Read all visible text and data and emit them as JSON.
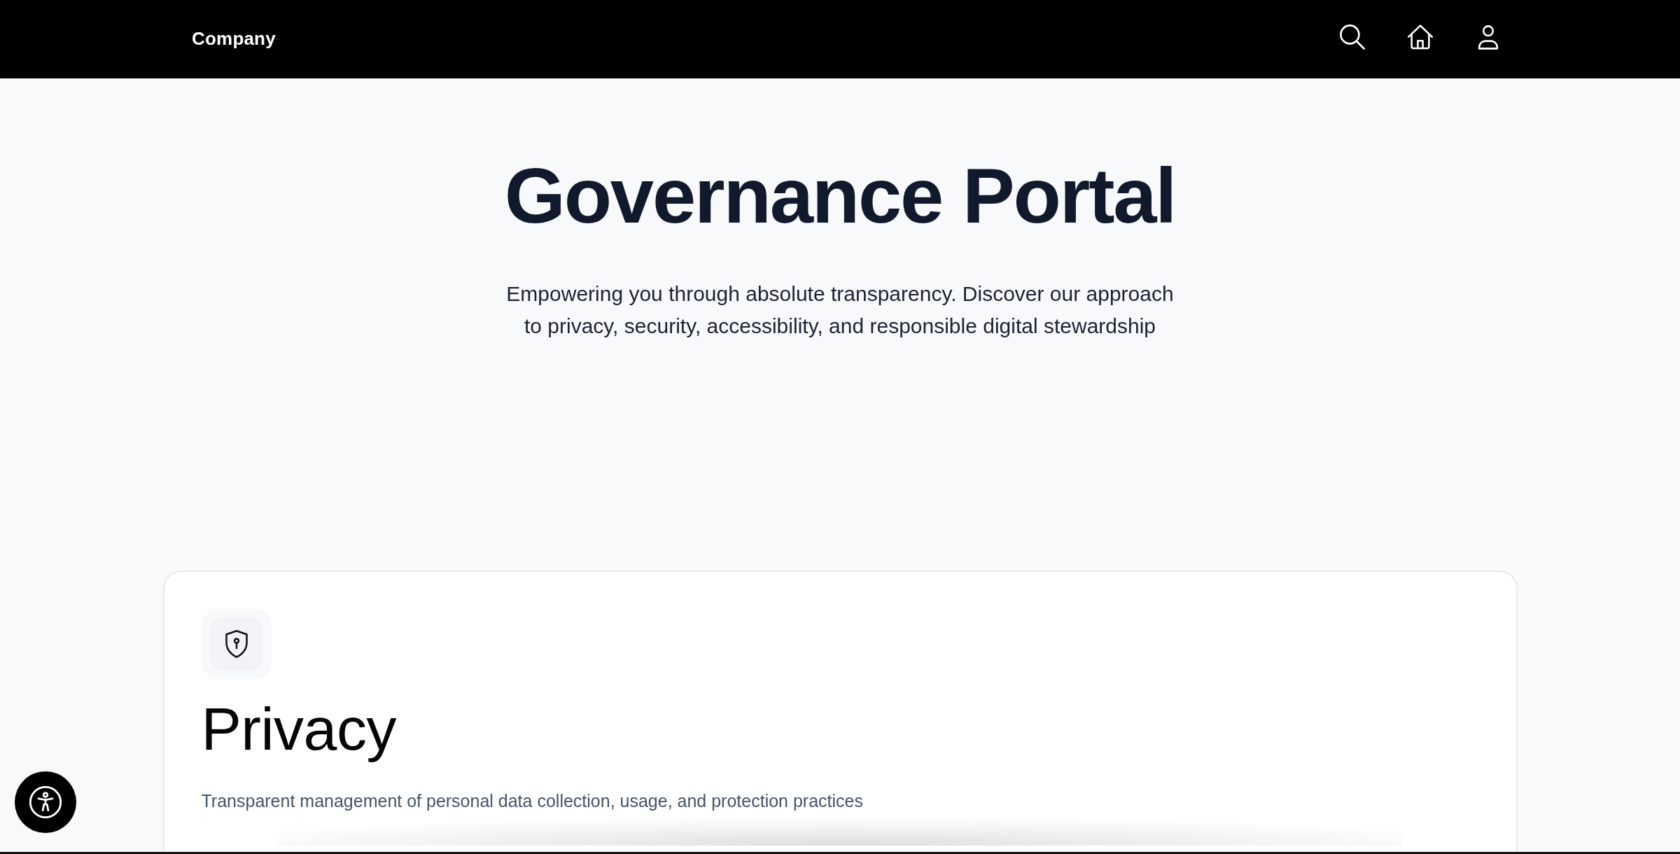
{
  "navbar": {
    "brand": "Company"
  },
  "hero": {
    "title": "Governance Portal",
    "subtitle": "Empowering you through absolute transparency. Discover our approach to privacy, security, accessibility, and responsible digital stewardship"
  },
  "cards": [
    {
      "title": "Privacy",
      "description": "Transparent management of personal data collection, usage, and protection practices"
    }
  ]
}
